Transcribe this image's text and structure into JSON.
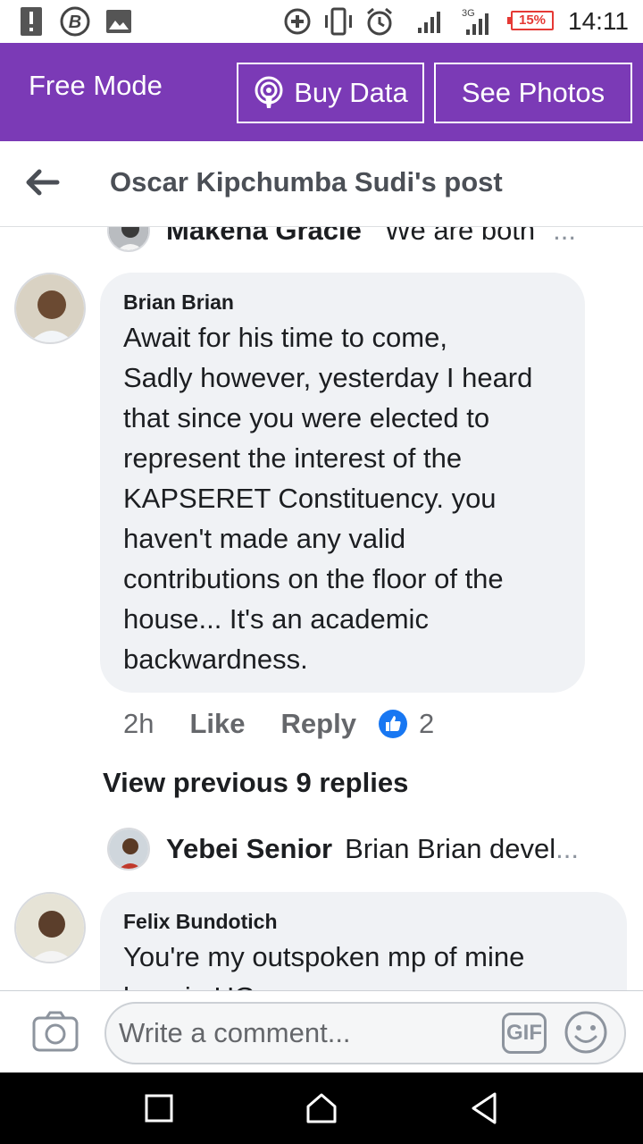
{
  "status_bar": {
    "time": "14:11",
    "battery": "15%",
    "network": "3G",
    "icons": [
      "warning-icon",
      "b-app-icon",
      "image-icon",
      "data-saver-icon",
      "vibrate-icon",
      "alarm-icon",
      "signal-icon",
      "signal-3g-icon",
      "battery-icon"
    ],
    "battery_color": "#e53935"
  },
  "header": {
    "mode": "Free Mode",
    "buy_data": "Buy Data",
    "see_photos": "See Photos",
    "background": "#7b3ab6"
  },
  "post_header": {
    "title": "Oscar Kipchumba Sudi's post"
  },
  "replies_top": {
    "name": "Makena Gracie",
    "text": "We are both",
    "more": "..."
  },
  "comment": {
    "author": "Brian Brian",
    "lines": [
      "Await for his time to come,",
      "Sadly however, yesterday I heard",
      "that since you were elected to",
      "represent the interest of the",
      "KAPSERET Constituency. you",
      "haven't made any valid",
      "contributions on the floor of the",
      "house... It's an academic",
      "backwardness."
    ],
    "time": "2h",
    "like": "Like",
    "reply": "Reply",
    "reaction_count": "2"
  },
  "view_previous": "View previous 9 replies",
  "reply_preview": {
    "name": "Yebei Senior",
    "text": "Brian Brian devel",
    "more": "..."
  },
  "comment2": {
    "author": "Felix Bundotich",
    "line1": "You're  my outspoken mp of mine",
    "line2": "ham in UG"
  },
  "composer": {
    "placeholder": "Write a comment...",
    "gif": "GIF"
  }
}
